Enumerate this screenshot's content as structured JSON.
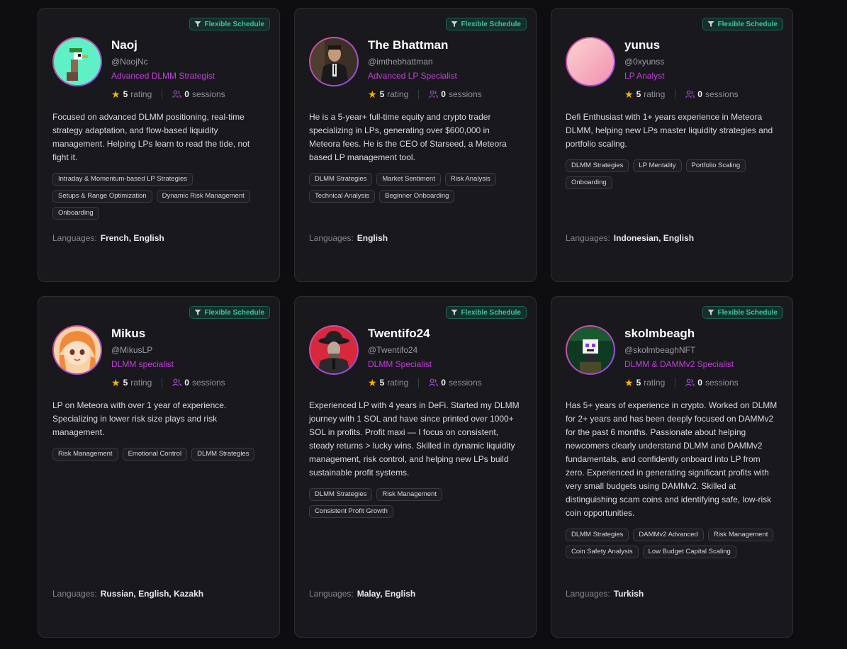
{
  "badge_label": "Flexible Schedule",
  "rating_suffix": "rating",
  "sessions_suffix": "sessions",
  "languages_label": "Languages:",
  "colors": {
    "accent_role": "#c23fd9",
    "schedule_green": "#3fc39b",
    "star": "#f5b400",
    "people_icon": "#a64ad6"
  },
  "mentors": [
    {
      "name": "Naoj",
      "handle": "@NaojNc",
      "role": "Advanced DLMM Strategist",
      "rating": "5",
      "sessions": "0",
      "bio": "Focused on advanced DLMM positioning, real-time strategy adaptation, and flow-based liquidity management. Helping LPs learn to read the tide, not fight it.",
      "tags": [
        "Intraday & Momentum-based LP Strategies",
        "Setups & Range Optimization",
        "Dynamic Risk Management",
        "Onboarding"
      ],
      "languages": "French, English",
      "avatar": "pixel-bird"
    },
    {
      "name": "The Bhattman",
      "handle": "@imthebhattman",
      "role": "Advanced LP Specialist",
      "rating": "5",
      "sessions": "0",
      "bio": "He is a 5-year+ full-time equity and crypto trader specializing in LPs, generating over $600,000 in Meteora fees. He is the CEO of Starseed, a Meteora based LP management tool.",
      "tags": [
        "DLMM Strategies",
        "Market Sentiment",
        "Risk Analysis",
        "Technical Analysis",
        "Beginner Onboarding"
      ],
      "languages": "English",
      "avatar": "suited-man"
    },
    {
      "name": "yunus",
      "handle": "@0xyunss",
      "role": "LP Analyst",
      "rating": "5",
      "sessions": "0",
      "bio": "Defi Enthusiast with 1+ years experience in Meteora DLMM, helping new LPs master liquidity strategies and portfolio scaling.",
      "tags": [
        "DLMM Strategies",
        "LP Mentality",
        "Portfolio Scaling",
        "Onboarding"
      ],
      "languages": "Indonesian, English",
      "avatar": "pink-gradient"
    },
    {
      "name": "Mikus",
      "handle": "@MikusLP",
      "role": "DLMM specialist",
      "rating": "5",
      "sessions": "0",
      "bio": "LP on Meteora with over 1 year of experience. Specializing in lower risk size plays and risk management.",
      "tags": [
        "Risk Management",
        "Emotional Control",
        "DLMM Strategies"
      ],
      "languages": "Russian, English, Kazakh",
      "avatar": "anime-girl"
    },
    {
      "name": "Twentifo24",
      "handle": "@Twentifo24",
      "role": "DLMM Specialist",
      "rating": "5",
      "sessions": "0",
      "bio": "Experienced LP with 4 years in DeFi. Started my DLMM journey with 1 SOL and have since printed over 1000+ SOL in profits. Profit maxi — I focus on consistent, steady returns > lucky wins. Skilled in dynamic liquidity management, risk control, and helping new LPs build sustainable profit systems.",
      "tags": [
        "DLMM Strategies",
        "Risk Management",
        "Consistent Profit Growth"
      ],
      "languages": "Malay, English",
      "avatar": "fedora-man"
    },
    {
      "name": "skolmbeagh",
      "handle": "@skolmbeaghNFT",
      "role": "DLMM & DAMMv2 Specialist",
      "rating": "5",
      "sessions": "0",
      "bio": "Has 5+ years of experience in crypto. Worked on DLMM for 2+ years and has been deeply focused on DAMMv2 for the past 6 months. Passionate about helping newcomers clearly understand DLMM and DAMMv2 fundamentals, and confidently onboard into LP from zero. Experienced in generating significant profits with very small budgets using DAMMv2. Skilled at distinguishing scam coins and identifying safe, low-risk coin opportunities.",
      "tags": [
        "DLMM Strategies",
        "DAMMv2 Advanced",
        "Risk Management",
        "Coin Safety Analysis",
        "Low Budget Capital Scaling"
      ],
      "languages": "Turkish",
      "avatar": "pixel-skull"
    }
  ]
}
